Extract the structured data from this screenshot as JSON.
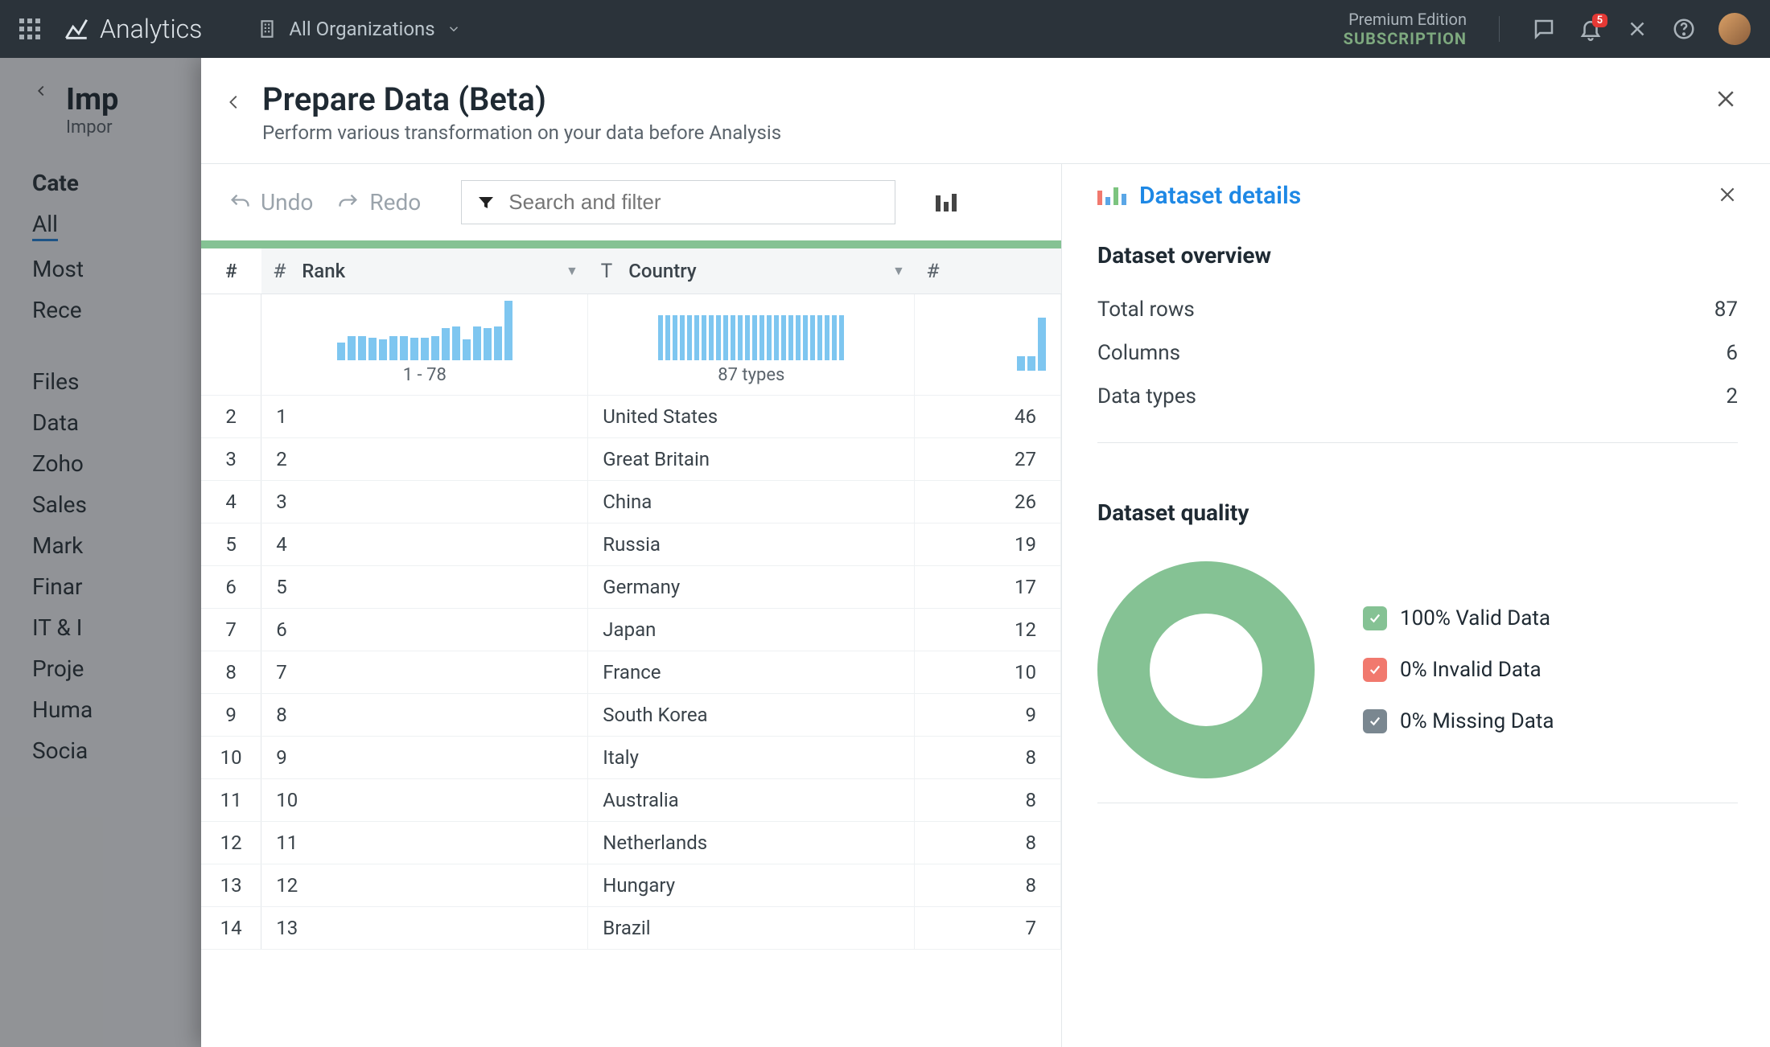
{
  "topbar": {
    "brand": "Analytics",
    "org_picker": "All Organizations",
    "edition_top": "Premium Edition",
    "edition_bottom": "SUBSCRIPTION",
    "notif_count": "5"
  },
  "bg": {
    "title": "Imp",
    "subtitle": "Impor",
    "cat_header": "Cate",
    "cats": [
      "All",
      "Most",
      "Rece",
      "",
      "Files",
      "Data",
      "Zoho",
      "Sales",
      "Mark",
      "Finar",
      "IT & I",
      "Proje",
      "Huma",
      "Socia"
    ]
  },
  "modal": {
    "title": "Prepare Data (Beta)",
    "subtitle": "Perform various transformation on your data before Analysis",
    "undo": "Undo",
    "redo": "Redo",
    "search_placeholder": "Search and filter"
  },
  "columns": {
    "rank": {
      "type": "#",
      "label": "Rank",
      "hist_label": "1 - 78",
      "bars": [
        22,
        30,
        30,
        28,
        26,
        30,
        30,
        28,
        28,
        30,
        40,
        42,
        26,
        42,
        40,
        42,
        74
      ]
    },
    "country": {
      "type": "T",
      "label": "Country",
      "hist_label": "87 types",
      "bars": [
        56,
        56,
        56,
        56,
        56,
        56,
        56,
        56,
        56,
        56,
        56,
        56,
        56,
        56,
        56,
        56,
        56,
        56,
        56,
        56,
        56,
        56,
        56,
        56,
        56,
        56
      ]
    },
    "gold": {
      "type": "#",
      "label": "",
      "hist_label": "",
      "bars": [
        18,
        18,
        66
      ]
    }
  },
  "rows": [
    {
      "n": "2",
      "rank": "1",
      "country": "United States",
      "gold": "46"
    },
    {
      "n": "3",
      "rank": "2",
      "country": "Great Britain",
      "gold": "27"
    },
    {
      "n": "4",
      "rank": "3",
      "country": "China",
      "gold": "26"
    },
    {
      "n": "5",
      "rank": "4",
      "country": "Russia",
      "gold": "19"
    },
    {
      "n": "6",
      "rank": "5",
      "country": "Germany",
      "gold": "17"
    },
    {
      "n": "7",
      "rank": "6",
      "country": "Japan",
      "gold": "12"
    },
    {
      "n": "8",
      "rank": "7",
      "country": "France",
      "gold": "10"
    },
    {
      "n": "9",
      "rank": "8",
      "country": "South Korea",
      "gold": "9"
    },
    {
      "n": "10",
      "rank": "9",
      "country": "Italy",
      "gold": "8"
    },
    {
      "n": "11",
      "rank": "10",
      "country": "Australia",
      "gold": "8"
    },
    {
      "n": "12",
      "rank": "11",
      "country": "Netherlands",
      "gold": "8"
    },
    {
      "n": "13",
      "rank": "12",
      "country": "Hungary",
      "gold": "8"
    },
    {
      "n": "14",
      "rank": "13",
      "country": "Brazil",
      "gold": "7"
    }
  ],
  "details": {
    "title": "Dataset details",
    "overview_title": "Dataset overview",
    "total_rows_label": "Total rows",
    "total_rows": "87",
    "columns_label": "Columns",
    "columns": "6",
    "dtypes_label": "Data types",
    "dtypes": "2",
    "quality_title": "Dataset quality",
    "legend_valid": "100% Valid Data",
    "legend_invalid": "0% Invalid Data",
    "legend_missing": "0% Missing Data"
  },
  "chart_data": {
    "type": "pie",
    "title": "Dataset quality",
    "series": [
      {
        "name": "Valid Data",
        "value": 100
      },
      {
        "name": "Invalid Data",
        "value": 0
      },
      {
        "name": "Missing Data",
        "value": 0
      }
    ]
  }
}
